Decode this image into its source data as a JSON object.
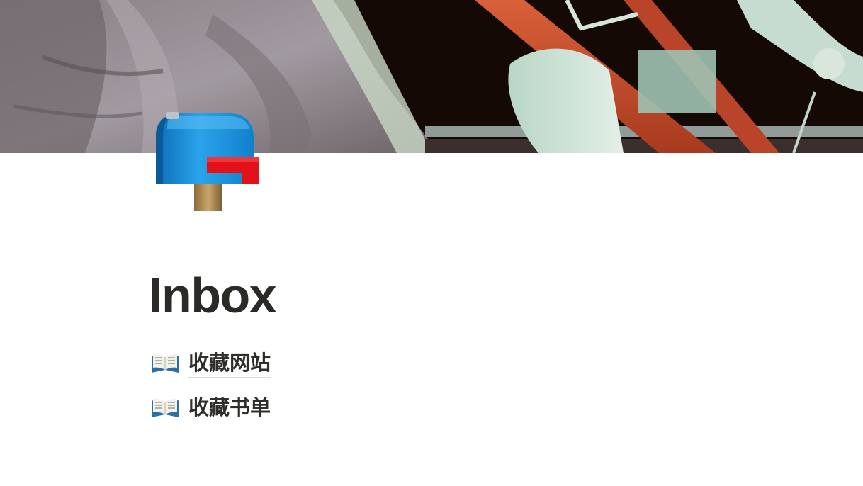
{
  "cover": {
    "icon": "astronaut-photo"
  },
  "page": {
    "icon": "mailbox-icon",
    "title": "Inbox"
  },
  "links": [
    {
      "icon": "open-book-icon",
      "label": "收藏网站"
    },
    {
      "icon": "open-book-icon",
      "label": "收藏书单"
    }
  ],
  "colors": {
    "title_text": "#2b2a27",
    "link_text": "#2f2e2b",
    "link_underline": "#dcdbd8",
    "mailbox_blue": "#1b8fd6",
    "mailbox_flag": "#e3121a"
  }
}
